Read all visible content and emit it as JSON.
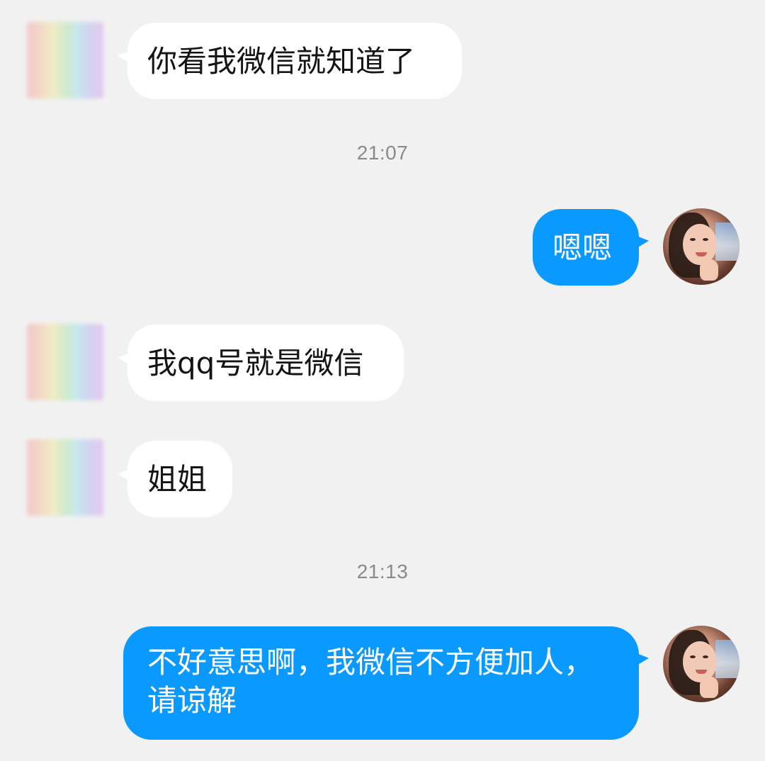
{
  "messages": [
    {
      "side": "in",
      "text": "你看我微信就知道了"
    },
    {
      "type": "time",
      "text": "21:07"
    },
    {
      "side": "out",
      "text": "嗯嗯"
    },
    {
      "side": "in",
      "text": "我qq号就是微信"
    },
    {
      "side": "in",
      "text": "姐姐"
    },
    {
      "type": "time",
      "text": "21:13"
    },
    {
      "side": "out",
      "text": "不好意思啊，我微信不方便加人，请谅解"
    }
  ],
  "colors": {
    "background": "#f1f1f1",
    "incoming_bubble": "#ffffff",
    "outgoing_bubble": "#0a99ff",
    "timestamp_text": "#8a8a8a"
  },
  "avatars": {
    "contact": "blurred-rainbow-avatar",
    "self": "girl-photo-avatar"
  }
}
